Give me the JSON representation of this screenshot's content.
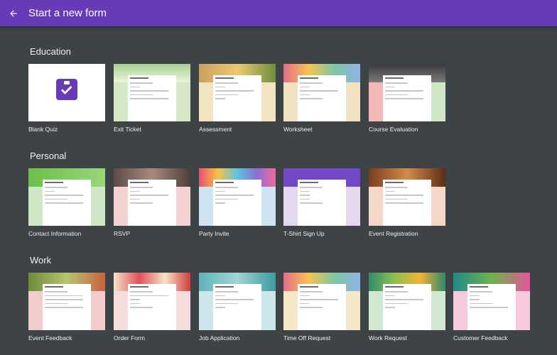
{
  "header": {
    "title": "Start a new form",
    "back_icon": "arrow-back-icon"
  },
  "sections": [
    {
      "title": "Education",
      "templates": [
        {
          "label": "Blank Quiz",
          "icon": "assignment-check-icon"
        },
        {
          "label": "Exit Ticket"
        },
        {
          "label": "Assessment"
        },
        {
          "label": "Worksheet"
        },
        {
          "label": "Course Evaluation"
        }
      ]
    },
    {
      "title": "Personal",
      "templates": [
        {
          "label": "Contact Information"
        },
        {
          "label": "RSVP"
        },
        {
          "label": "Party Invite"
        },
        {
          "label": "T-Shirt Sign Up"
        },
        {
          "label": "Event Registration"
        }
      ]
    },
    {
      "title": "Work",
      "templates": [
        {
          "label": "Event Feedback"
        },
        {
          "label": "Order Form"
        },
        {
          "label": "Job Application"
        },
        {
          "label": "Time Off Request"
        },
        {
          "label": "Work Request"
        },
        {
          "label": "Customer Feedback"
        }
      ]
    }
  ],
  "colors": {
    "header": "#673ab7",
    "background": "#3e4446",
    "quiz_accent": "#673ab7"
  }
}
